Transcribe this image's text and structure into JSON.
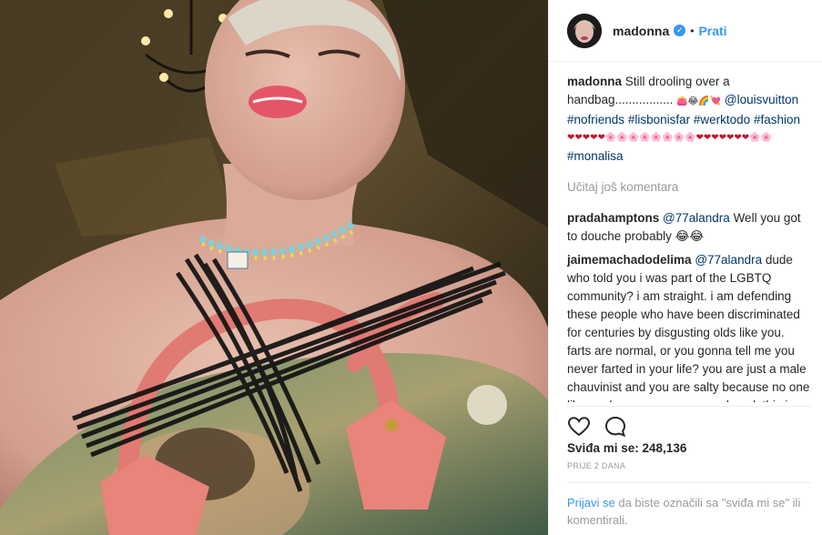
{
  "post": {
    "username": "madonna",
    "verified_icon": "verified-badge-icon",
    "separator": "•",
    "follow_label": "Prati"
  },
  "caption": {
    "username": "madonna",
    "text": "Still drooling over a handbag.................",
    "emojis": "👛😂🌈💘",
    "mention": "@louisvuitton",
    "hashtags": [
      "#nofriends",
      "#lisbonisfar",
      "#werktodo",
      "#fashion"
    ],
    "emoji_row": "❤❤❤❤❤🌸🌸🌸🌸🌸🌸🌸🌸❤❤❤❤❤❤❤🌸🌸",
    "last_tag": "#monalisa"
  },
  "load_more": "Učitaj još komentara",
  "comments": [
    {
      "username": "pradahamptons",
      "mention": "@77alandra",
      "text": "Well you got to douche probably 😂😂"
    },
    {
      "username": "jaimemachadodelima",
      "mention": "@77alandra",
      "text": "dude who told you i was part of the LGBTQ community? i am straight. i am defending these people who have been discriminated for centuries by disgusting olds like you. farts are normal, or you gonna tell me you never farted in your life? you are just a male chauvinist and you are salty because no one likes or loves you. you are unloved. this is the reason why. you are close minded as well you cant differ people in"
    }
  ],
  "actions": {
    "like_icon": "heart-icon",
    "comment_icon": "comment-icon"
  },
  "likes": "Sviđa mi se: 248,136",
  "timestamp": "PRIJE 2 DANA",
  "login_prompt": {
    "link": "Prijavi se",
    "text": " da biste označili sa \"sviđa mi se\" ili komentirali."
  },
  "colors": {
    "link_blue": "#3897f0",
    "tag_blue": "#003569",
    "muted": "#999999"
  }
}
